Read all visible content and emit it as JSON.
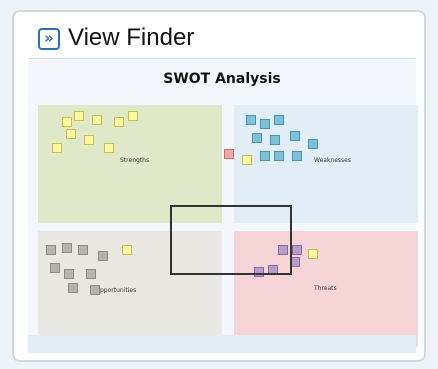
{
  "panel": {
    "title": "View Finder",
    "expand_icon_glyph": "»",
    "expand_icon": "double-chevron-right-icon"
  },
  "swot": {
    "title": "SWOT Analysis",
    "quadrants": {
      "strengths": {
        "label": "Strengths",
        "color": "#dfe9c9"
      },
      "weaknesses": {
        "label": "Weaknesses",
        "color": "#e1eef7"
      },
      "opportunities": {
        "label": "pportunities",
        "color": "#e9e8e2"
      },
      "threats": {
        "label": "Threats",
        "color": "#f7d5d6"
      }
    }
  },
  "colors": {
    "accent": "#2a6fbe",
    "note_yellow": "#fff9a6",
    "note_grey": "#b5b4aa",
    "note_blue": "#7cc1d8",
    "note_purple": "#b59cc9",
    "note_pink": "#f0a6a6"
  }
}
